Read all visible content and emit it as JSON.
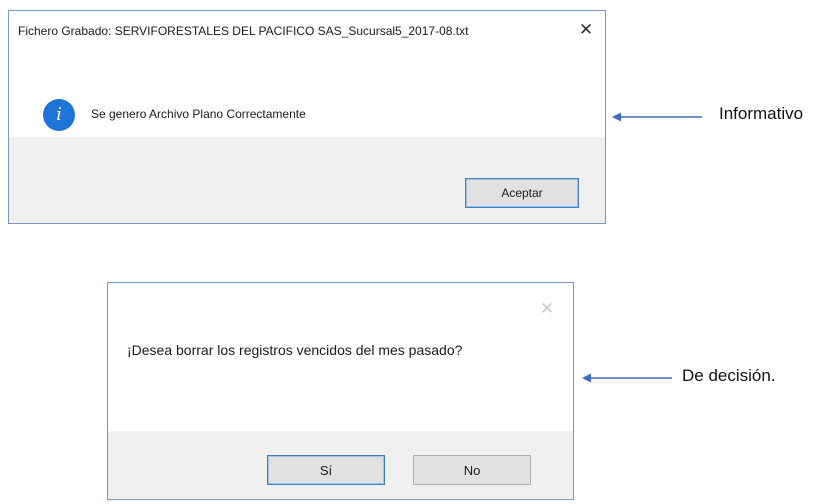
{
  "dialog_info": {
    "title": "Fichero Grabado: SERVIFORESTALES DEL PACIFICO SAS_Sucursal5_2017-08.txt",
    "close_glyph": "✕",
    "icon": "info-icon",
    "icon_glyph": "i",
    "message": "Se genero Archivo Plano Correctamente",
    "ok_label": "Aceptar"
  },
  "dialog_decision": {
    "close_glyph": "✕",
    "message": "¡Desea borrar los registros vencidos del mes pasado?",
    "yes_label": "Sí",
    "no_label": "No"
  },
  "annotations": {
    "informative": "Informativo",
    "decision": "De decisión."
  },
  "colors": {
    "accent": "#1e73d6",
    "footer": "#f0f0f0",
    "arrow": "#3f6fc0"
  }
}
